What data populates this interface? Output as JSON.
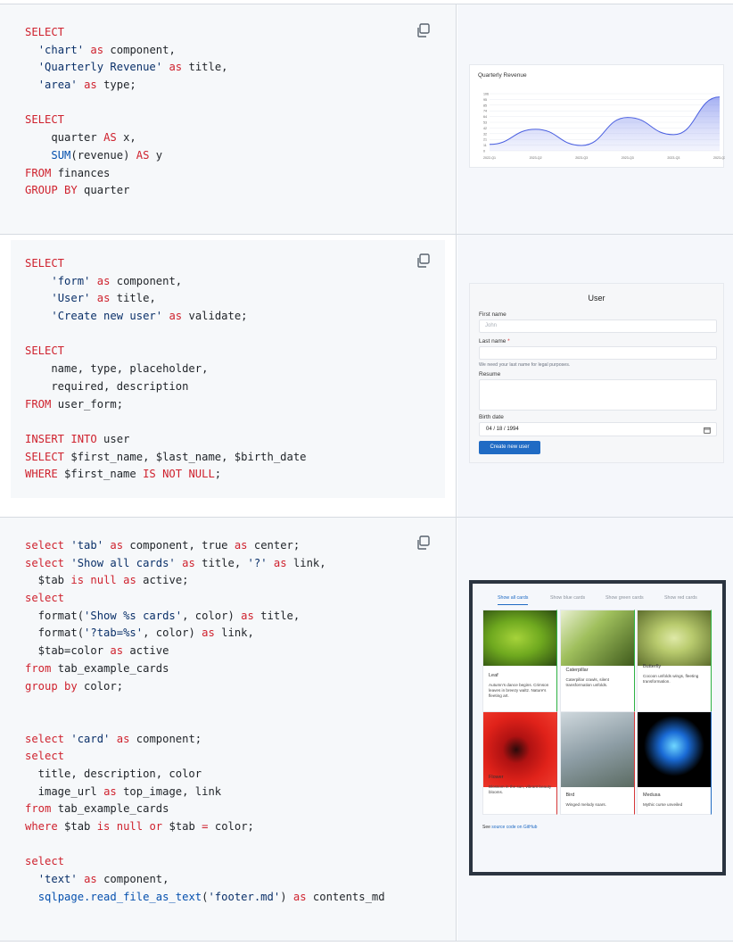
{
  "blocks": [
    {
      "code_lines": [
        [
          [
            "kw",
            "SELECT"
          ]
        ],
        [
          [
            "t",
            "  "
          ],
          [
            "str",
            "'chart'"
          ],
          [
            "t",
            " "
          ],
          [
            "kw",
            "as"
          ],
          [
            "t",
            " component,"
          ]
        ],
        [
          [
            "t",
            "  "
          ],
          [
            "str",
            "'Quarterly Revenue'"
          ],
          [
            "t",
            " "
          ],
          [
            "kw",
            "as"
          ],
          [
            "t",
            " title,"
          ]
        ],
        [
          [
            "t",
            "  "
          ],
          [
            "str",
            "'area'"
          ],
          [
            "t",
            " "
          ],
          [
            "kw",
            "as"
          ],
          [
            "t",
            " type;"
          ]
        ],
        [
          [
            "t",
            ""
          ]
        ],
        [
          [
            "kw",
            "SELECT"
          ]
        ],
        [
          [
            "t",
            "    quarter "
          ],
          [
            "kw",
            "AS"
          ],
          [
            "t",
            " x,"
          ]
        ],
        [
          [
            "t",
            "    "
          ],
          [
            "fn",
            "SUM"
          ],
          [
            "t",
            "(revenue) "
          ],
          [
            "kw",
            "AS"
          ],
          [
            "t",
            " y"
          ]
        ],
        [
          [
            "kw",
            "FROM"
          ],
          [
            "t",
            " finances"
          ]
        ],
        [
          [
            "kw",
            "GROUP BY"
          ],
          [
            "t",
            " quarter"
          ]
        ]
      ]
    },
    {
      "code_lines": [
        [
          [
            "kw",
            "SELECT"
          ]
        ],
        [
          [
            "t",
            "    "
          ],
          [
            "str",
            "'form'"
          ],
          [
            "t",
            " "
          ],
          [
            "kw",
            "as"
          ],
          [
            "t",
            " component,"
          ]
        ],
        [
          [
            "t",
            "    "
          ],
          [
            "str",
            "'User'"
          ],
          [
            "t",
            " "
          ],
          [
            "kw",
            "as"
          ],
          [
            "t",
            " title,"
          ]
        ],
        [
          [
            "t",
            "    "
          ],
          [
            "str",
            "'Create new user'"
          ],
          [
            "t",
            " "
          ],
          [
            "kw",
            "as"
          ],
          [
            "t",
            " validate;"
          ]
        ],
        [
          [
            "t",
            ""
          ]
        ],
        [
          [
            "kw",
            "SELECT"
          ]
        ],
        [
          [
            "t",
            "    name, type, placeholder,"
          ]
        ],
        [
          [
            "t",
            "    required, description"
          ]
        ],
        [
          [
            "kw",
            "FROM"
          ],
          [
            "t",
            " user_form;"
          ]
        ],
        [
          [
            "t",
            ""
          ]
        ],
        [
          [
            "kw",
            "INSERT INTO"
          ],
          [
            "t",
            " user"
          ]
        ],
        [
          [
            "kw",
            "SELECT"
          ],
          [
            "t",
            " $first_name, $last_name, $birth_date"
          ]
        ],
        [
          [
            "kw",
            "WHERE"
          ],
          [
            "t",
            " $first_name "
          ],
          [
            "kw",
            "IS NOT NULL"
          ],
          [
            "t",
            ";"
          ]
        ]
      ]
    },
    {
      "code_lines": [
        [
          [
            "kw",
            "select"
          ],
          [
            "t",
            " "
          ],
          [
            "str",
            "'tab'"
          ],
          [
            "t",
            " "
          ],
          [
            "kw",
            "as"
          ],
          [
            "t",
            " component, true "
          ],
          [
            "kw",
            "as"
          ],
          [
            "t",
            " center;"
          ]
        ],
        [
          [
            "kw",
            "select"
          ],
          [
            "t",
            " "
          ],
          [
            "str",
            "'Show all cards'"
          ],
          [
            "t",
            " "
          ],
          [
            "kw",
            "as"
          ],
          [
            "t",
            " title, "
          ],
          [
            "str",
            "'?'"
          ],
          [
            "t",
            " "
          ],
          [
            "kw",
            "as"
          ],
          [
            "t",
            " link,"
          ]
        ],
        [
          [
            "t",
            "  $tab "
          ],
          [
            "kw",
            "is"
          ],
          [
            "t",
            " "
          ],
          [
            "kw",
            "null"
          ],
          [
            "t",
            " "
          ],
          [
            "kw",
            "as"
          ],
          [
            "t",
            " active;"
          ]
        ],
        [
          [
            "kw",
            "select"
          ]
        ],
        [
          [
            "t",
            "  format("
          ],
          [
            "str",
            "'Show %s cards'"
          ],
          [
            "t",
            ", color) "
          ],
          [
            "kw",
            "as"
          ],
          [
            "t",
            " title,"
          ]
        ],
        [
          [
            "t",
            "  format("
          ],
          [
            "str",
            "'?tab=%s'"
          ],
          [
            "t",
            ", color) "
          ],
          [
            "kw",
            "as"
          ],
          [
            "t",
            " link,"
          ]
        ],
        [
          [
            "t",
            "  $tab=color "
          ],
          [
            "kw",
            "as"
          ],
          [
            "t",
            " active"
          ]
        ],
        [
          [
            "kw",
            "from"
          ],
          [
            "t",
            " tab_example_cards"
          ]
        ],
        [
          [
            "kw",
            "group by"
          ],
          [
            "t",
            " color;"
          ]
        ],
        [
          [
            "t",
            ""
          ]
        ],
        [
          [
            "t",
            ""
          ]
        ],
        [
          [
            "kw",
            "select"
          ],
          [
            "t",
            " "
          ],
          [
            "str",
            "'card'"
          ],
          [
            "t",
            " "
          ],
          [
            "kw",
            "as"
          ],
          [
            "t",
            " component;"
          ]
        ],
        [
          [
            "kw",
            "select"
          ]
        ],
        [
          [
            "t",
            "  title, description, color"
          ]
        ],
        [
          [
            "t",
            "  image_url "
          ],
          [
            "kw",
            "as"
          ],
          [
            "t",
            " top_image, link"
          ]
        ],
        [
          [
            "kw",
            "from"
          ],
          [
            "t",
            " tab_example_cards"
          ]
        ],
        [
          [
            "kw",
            "where"
          ],
          [
            "t",
            " $tab "
          ],
          [
            "kw",
            "is"
          ],
          [
            "t",
            " "
          ],
          [
            "kw",
            "null"
          ],
          [
            "t",
            " "
          ],
          [
            "kw",
            "or"
          ],
          [
            "t",
            " $tab "
          ],
          [
            "kw",
            "="
          ],
          [
            "t",
            " color;"
          ]
        ],
        [
          [
            "t",
            ""
          ]
        ],
        [
          [
            "kw",
            "select"
          ]
        ],
        [
          [
            "t",
            "  "
          ],
          [
            "str",
            "'text'"
          ],
          [
            "t",
            " "
          ],
          [
            "kw",
            "as"
          ],
          [
            "t",
            " component,"
          ]
        ],
        [
          [
            "t",
            "  "
          ],
          [
            "fn",
            "sqlpage.read_file_as_text"
          ],
          [
            "t",
            "("
          ],
          [
            "str",
            "'footer.md'"
          ],
          [
            "t",
            ") "
          ],
          [
            "kw",
            "as"
          ],
          [
            "t",
            " contents_md"
          ]
        ]
      ]
    }
  ],
  "copy_icon": "copy-icon",
  "colors": {
    "keyword": "#cf222e",
    "string": "#0a3069",
    "function": "#0550ae",
    "accent": "#206bc4"
  },
  "chart_preview": {
    "chart_data": {
      "type": "area",
      "title": "Quarterly Revenue",
      "categories": [
        "2022-Q1",
        "2023-Q2",
        "2023-Q3",
        "2023-Q3",
        "2023-Q3",
        "2023-Q3"
      ],
      "values": [
        12,
        40,
        10,
        62,
        30,
        100
      ],
      "y_ticks": [
        "106",
        "95",
        "85",
        "74",
        "64",
        "53",
        "42",
        "32",
        "21",
        "11",
        "0"
      ],
      "ylim": [
        0,
        106
      ]
    }
  },
  "form_preview": {
    "title": "User",
    "first_name_label": "First name",
    "first_name_placeholder": "John",
    "last_name_label": "Last name",
    "required_mark": "*",
    "last_name_help": "We need your last name for legal purposes.",
    "resume_label": "Resume",
    "birth_label": "Birth date",
    "birth_value": "04 / 18 / 1994",
    "calendar_icon": "calendar-icon",
    "submit_label": "Create new user"
  },
  "cards_preview": {
    "tabs": [
      "Show all cards",
      "Show blue cards",
      "Show green cards",
      "Show red cards"
    ],
    "cards": [
      {
        "title": "Leaf",
        "desc": "Autumn's dance begins. Crimson leaves in breezy waltz. Nature's fleeting art.",
        "color": "green"
      },
      {
        "title": "Caterpillar",
        "desc": "Caterpillar crawls, silent transformation unfolds.",
        "color": "green"
      },
      {
        "title": "Butterfly",
        "desc": "Cocoon unfolds wings, fleeting transformation.",
        "color": "green"
      },
      {
        "title": "Flower",
        "desc": "Blossom in the sun, vibrant beauty blooms.",
        "color": "red"
      },
      {
        "title": "Bird",
        "desc": "Winged melody soars.",
        "color": "red"
      },
      {
        "title": "Medusa",
        "desc": "Mythic curse unveiled",
        "color": "blue"
      }
    ],
    "footer_prefix": "See ",
    "footer_link": "source code on GitHub"
  }
}
